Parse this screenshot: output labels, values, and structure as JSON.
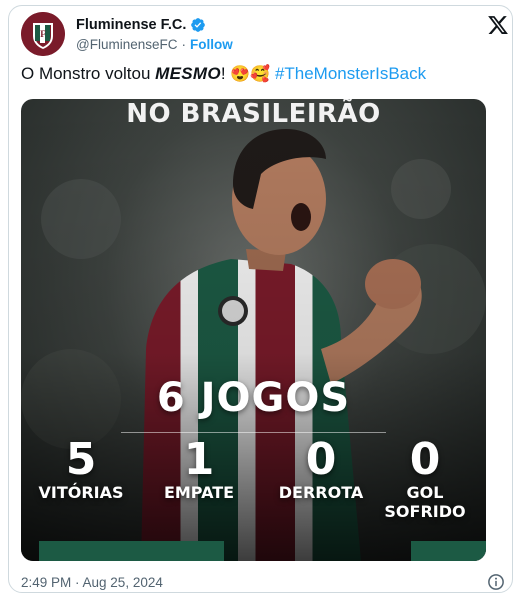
{
  "tweet": {
    "display_name": "Fluminense F.C.",
    "handle": "@FluminenseFC",
    "separator": "·",
    "follow_label": "Follow",
    "text_before": "O Monstro voltou ",
    "text_emphasis": "MESMO",
    "text_after": "! ",
    "emojis": "😍🥰",
    "hashtag": "#TheMonsterIsBack",
    "timestamp": "2:49 PM · Aug 25, 2024"
  },
  "media": {
    "headline": "NO BRASILEIRÃO",
    "games": "6 JOGOS",
    "stats": [
      {
        "value": "5",
        "label": "VITÓRIAS"
      },
      {
        "value": "1",
        "label": "EMPATE"
      },
      {
        "value": "0",
        "label": "DERROTA"
      },
      {
        "value": "0",
        "label_line1": "GOL",
        "label_line2": "SOFRIDO"
      }
    ]
  },
  "icons": {
    "avatar": "fluminense-crest-icon",
    "verified": "verified-badge-icon",
    "platform": "x-logo-icon",
    "info": "info-icon"
  },
  "colors": {
    "link_blue": "#1d9bf0",
    "text_primary": "#0f1419",
    "text_secondary": "#536471",
    "club_grena": "#7a1b2a",
    "club_green": "#1c5a44"
  }
}
